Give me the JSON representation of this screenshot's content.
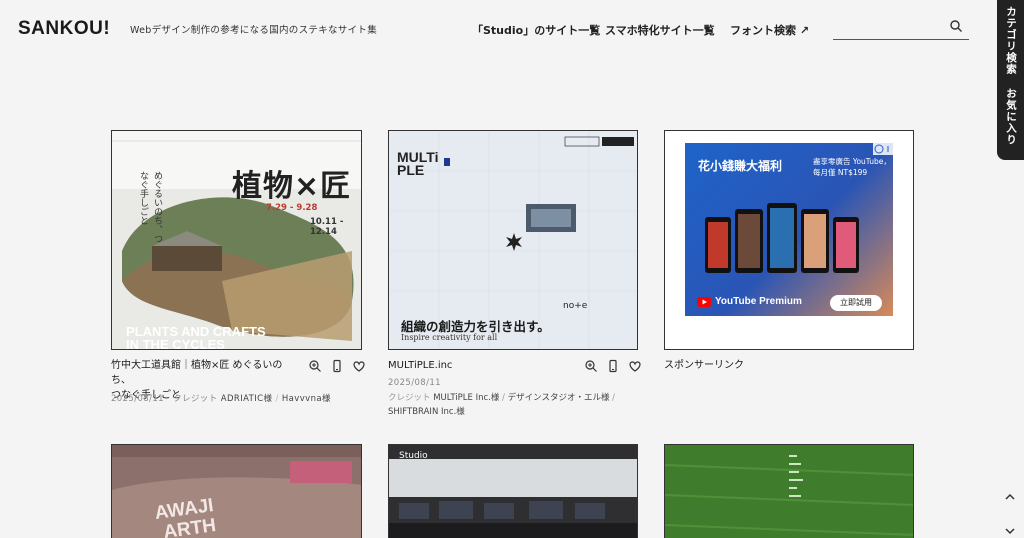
{
  "header": {
    "logo": "SANKOU!",
    "tagline": "Webデザイン制作の参考になる国内のステキなサイト集",
    "nav": [
      {
        "label": "「Studio」のサイト一覧"
      },
      {
        "label": "スマホ特化サイト一覧"
      },
      {
        "label": "フォント検索 ↗"
      }
    ],
    "search_placeholder": ""
  },
  "sidetab": {
    "category": "カテゴリ検索",
    "favorites": "お気に入り"
  },
  "cards": [
    {
      "title_line1": "竹中大工道具館｜植物×匠 めぐるいのち、",
      "title_line2": "つなぐ手しごと",
      "date": "2025/08/11",
      "credit_label": "クレジット",
      "credit_1": "ADRIATIC様",
      "credit_2": "Havvvna様",
      "thumb": {
        "heading": "植物×匠",
        "vertical": "めぐるいのち、つなぐ手しごと",
        "caption1": "PLANTS AND CRAFTS",
        "caption2": "IN THE CYCLES",
        "dates1": "7.29 - 9.28",
        "dates2": "10.11 - 12.14"
      }
    },
    {
      "title": "MULTiPLE.inc",
      "date": "2025/08/11",
      "credit_label": "クレジット",
      "credit_1": "MULTiPLE Inc.様",
      "credit_2": "デザインスタジオ・エル様",
      "credit_3": "SHIFTBRAIN Inc.様",
      "thumb": {
        "logo_line1": "MULTi",
        "logo_line2": "PLE",
        "headline": "組織の創造力を引き出す。",
        "sub": "Inspire creativity for all",
        "note": "no+e"
      }
    },
    {
      "title": "スポンサーリンク",
      "ad": {
        "headline": "花小錢賺大福利",
        "offer_line1": "盡享零廣告 YouTube，",
        "offer_line2": "每月僅 NT$199",
        "brand": "YouTube Premium",
        "cta": "立即試用"
      }
    }
  ],
  "row2": [
    {
      "label": "AWAJI",
      "label2": "ARTH"
    },
    {
      "label": "Studio"
    },
    {
      "label": ""
    }
  ],
  "colors": {
    "background": "#f4f4f4",
    "ad_blue": "#1e63c9",
    "youtube_red": "#ff0000",
    "field_green": "#3c7a2c"
  }
}
